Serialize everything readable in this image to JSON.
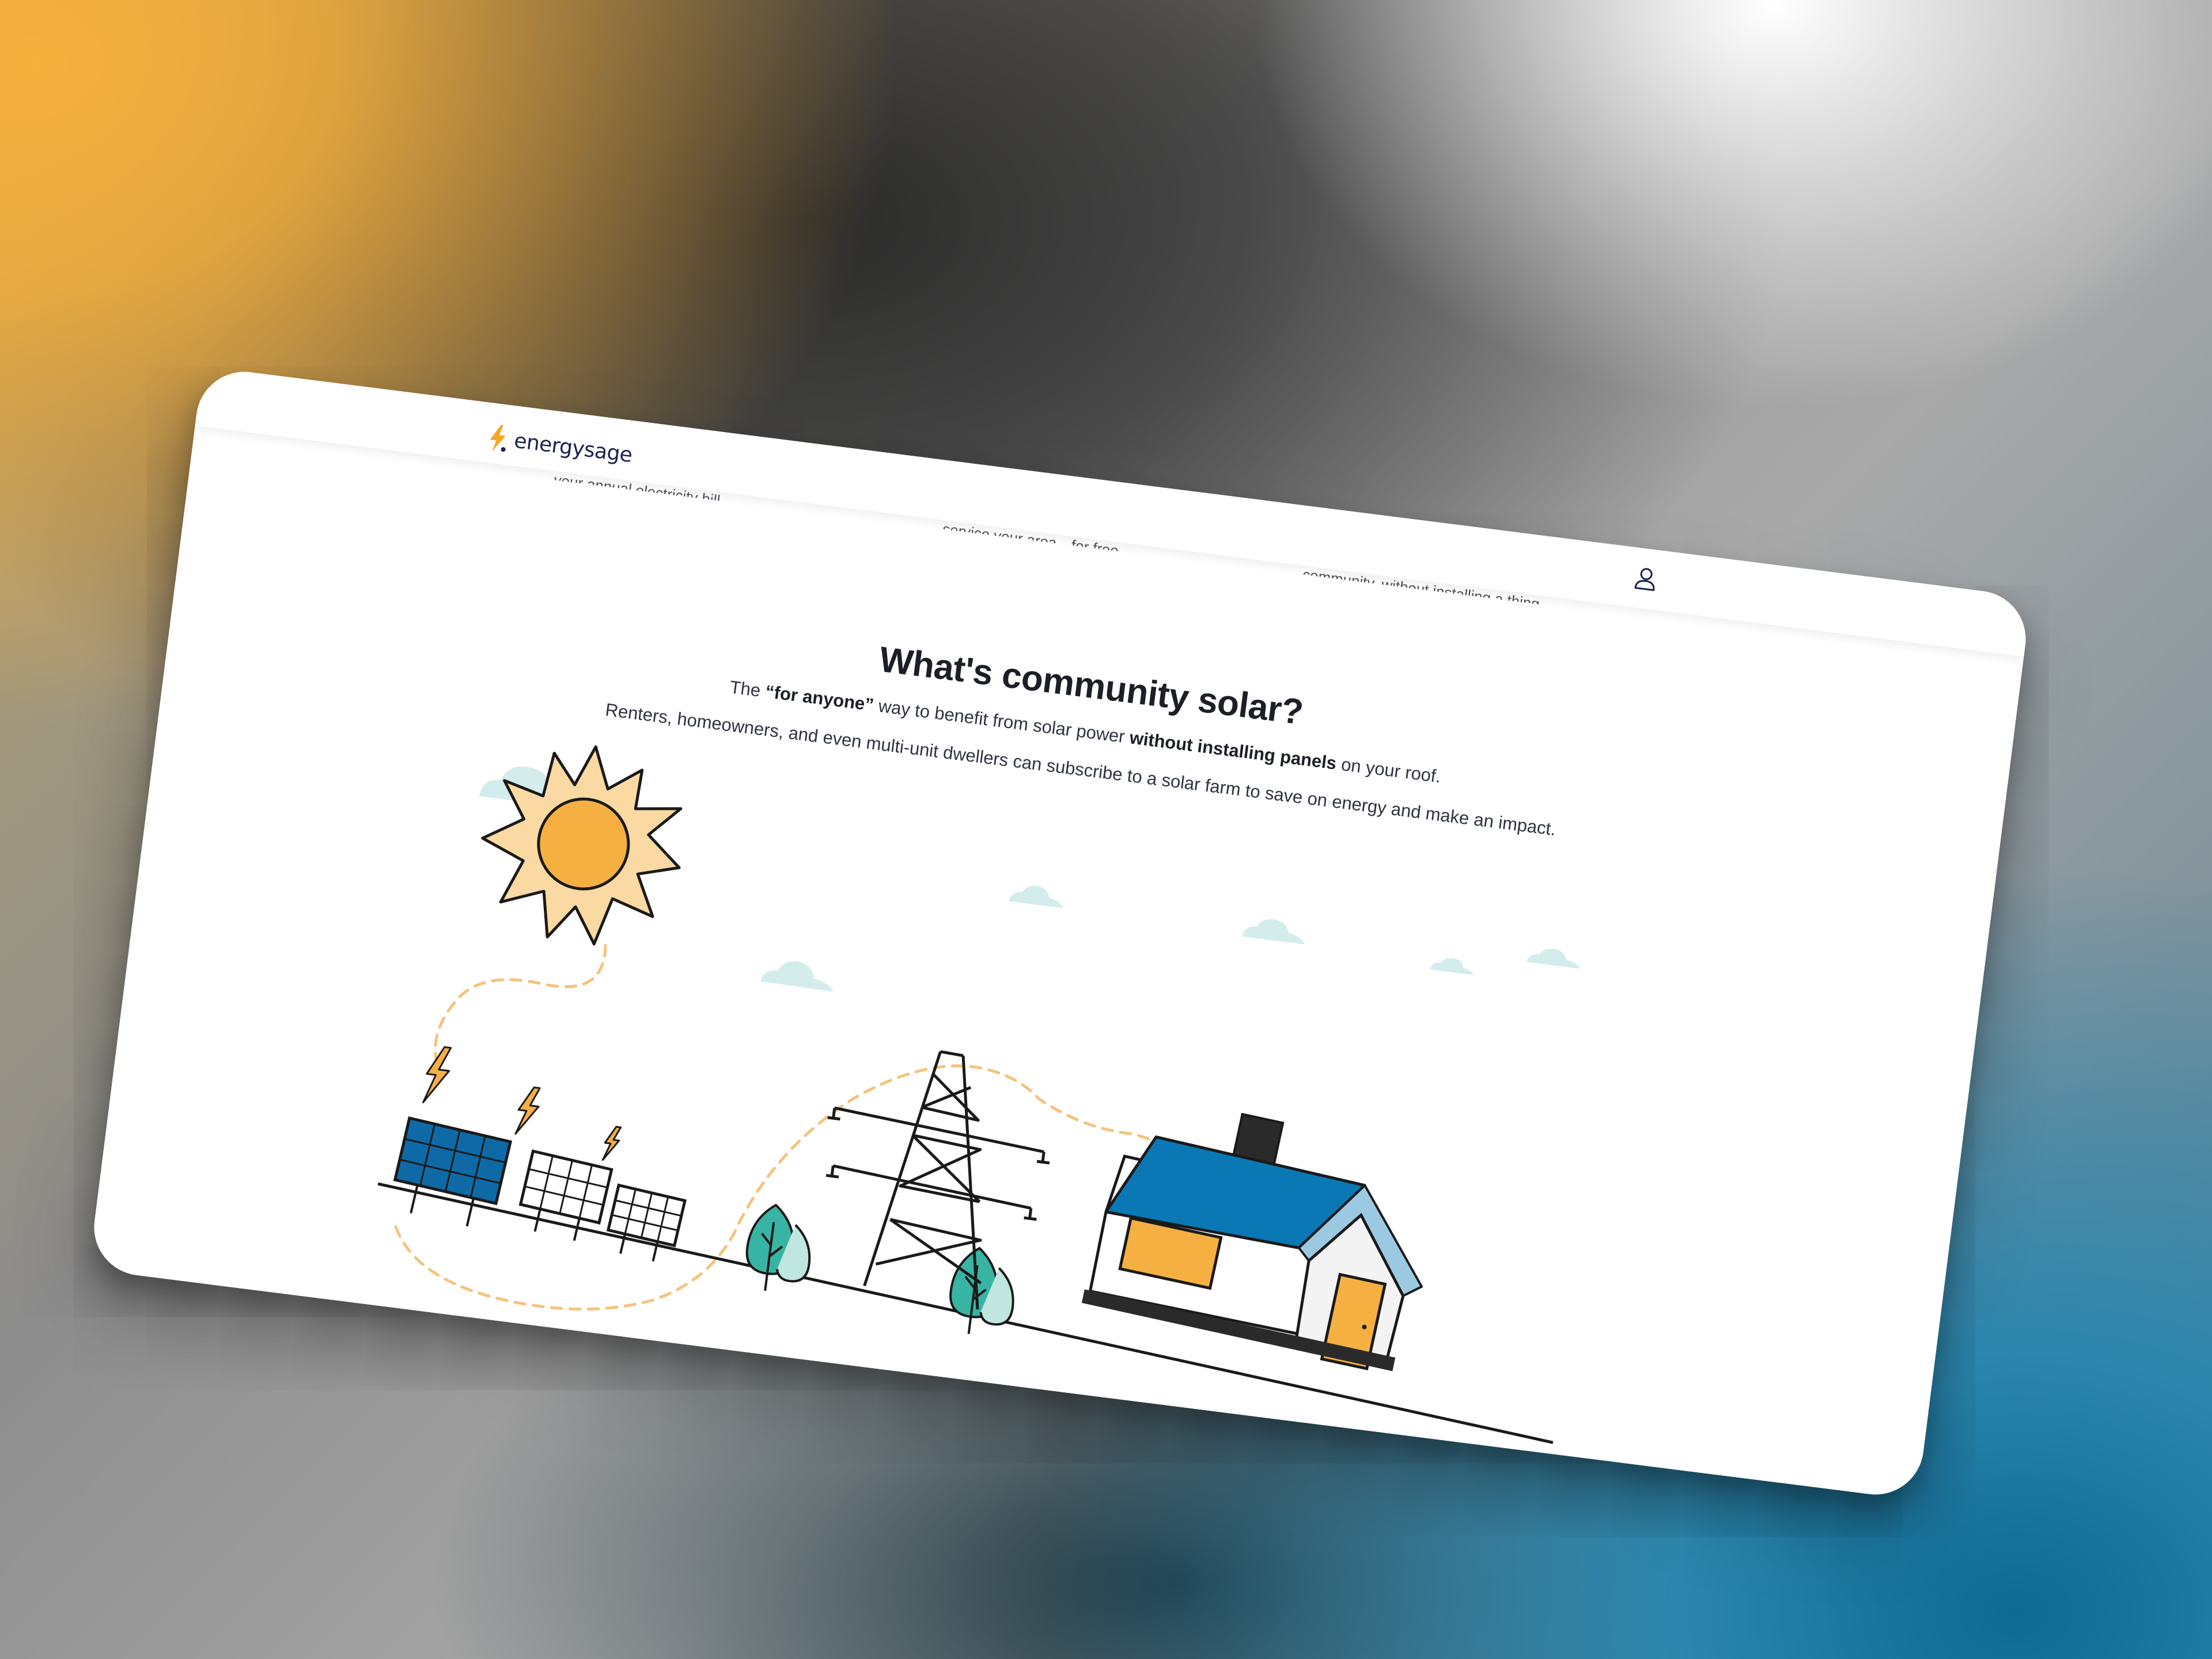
{
  "brand": {
    "name": "energysage",
    "mark_color": "#f5a623",
    "text_color": "#1b2150"
  },
  "header": {
    "account_icon": "user-icon"
  },
  "previous_section": {
    "snippets": [
      "your annual electricity bill.",
      "service your area—for free.",
      "community, without installing a thing."
    ]
  },
  "section": {
    "title": "What's community solar?",
    "subtitle_parts": {
      "p1": "The ",
      "p2": "“for anyone”",
      "p3": " way to benefit from solar power ",
      "p4": "without installing panels",
      "p5": " on your roof."
    },
    "description": "Renters, homeowners, and even multi-unit dwellers can subscribe to a solar farm to save on energy and make an impact."
  },
  "colors": {
    "sun": "#f6b042",
    "sun_rays": "#fbd9a3",
    "panel_blue": "#0e6aa6",
    "roof": "#0a78b5",
    "roof_edge": "#9cc9e2",
    "window_door": "#f6b042",
    "tree": "#38b4a4",
    "tree_light": "#bfe6df",
    "cloud": "#d3ecec",
    "dashed_path": "#f5c27c",
    "outline": "#1a1a1a"
  }
}
